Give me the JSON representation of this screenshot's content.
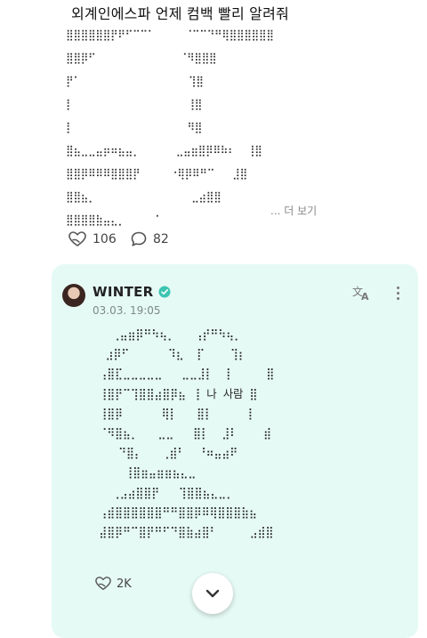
{
  "post1": {
    "title": "외계인에스파 언제 컴백 빨리 알려줘",
    "art": "⣿⣿⣿⣿⣿⣿⡟⠟⠋⠉⠉⠁     ⠈⠉⠉⠙⠛⢿⣿⣿⣿⣿⣿⣿\n⣿⣿⡿⠋              ⠈⠻⣿⣿⣿\n⡟⠁                  ⢹⣿\n⡇                   ⢸⣿\n⡇                   ⠻⣿\n⣿⣦⣀⣀⣤⡶⠶⣦⣤⡀      ⣀⣤⣶⣿⡿⠿⠷⠆  ⢸⣿\n⣿⣿⡿⠿⠿⠿⣿⣿⣿⡟     ⠐⢿⡿⠿⠛⠉   ⣸⣿\n⣿⣿⣦⡀                ⣀⣴⣿⣿\n⣿⣿⣿⣿⣷⣤⣄⡀     ⠁",
    "more_label": "... 더 보기",
    "likes": "106",
    "comments": "82"
  },
  "post2": {
    "author": "WINTER",
    "time": "03.03. 19:05",
    "art": "   ⢀⣤⣶⡿⠛⠳⢦⡀   ⢠⡞⠛⠳⢦⡀\n  ⣰⡿⠋      ⠹⣆  ⡏    ⢹⡆\n ⢠⣿⣏⣀⣀⣀⣀⣀   ⣀⣀⣸⡇  ⡇     ⣿\n ⢸⣿⡟⠉⢹⣿⣿⣴⣿⡿⣦ ⢸ 나 사람 ⣿\n ⢸⣿⡿      ⢿⡇   ⣿⡇     ⢸\n ⠈⠻⣿⣦⡀   ⣀⣀   ⣿⡇  ⣸⠇    ⣾\n    ⠙⣿⡄   ⢀⣾⠃  ⠘⠶⣤⣴⠟\n     ⢸⣿⣶⣤⣶⣶⣦⣄⣀\n   ⢀⣠⣴⣿⣿⡟   ⢹⣿⣿⣦⣄⣀⡀\n ⢠⣾⣿⣿⣿⣿⣿⣿⠛⠛⣿⣿⡿⠿⢿⣿⣿⣿⣷⣦\n ⣼⣿⡿⠛⠉⣿⡟⠛⠋⠙⣿⣷⣴⣿⠃     ⣠⣾⣿",
    "likes": "2K"
  },
  "colors": {
    "card_bg": "#e6faf5",
    "verified": "#3cc5b0"
  },
  "icons": {
    "like": "heart-hand-icon",
    "comment": "speech-bubble-icon",
    "verified": "verified-badge-icon",
    "translate": "translate-icon",
    "more": "vertical-ellipsis-icon",
    "scroll": "chevron-down-icon"
  }
}
